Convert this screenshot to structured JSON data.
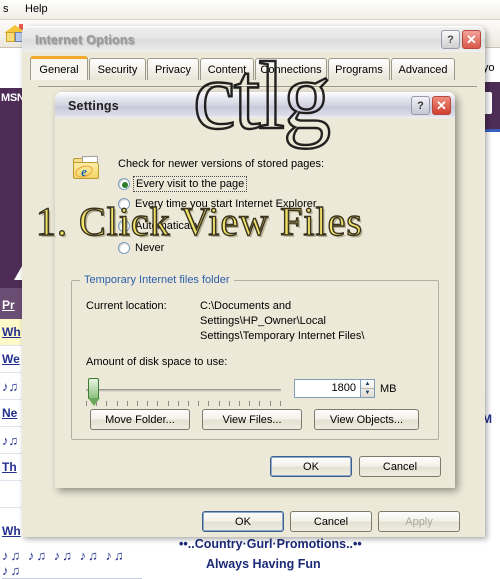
{
  "background": {
    "menu": [
      {
        "label": "s",
        "name": "menu-tools-partial"
      },
      {
        "label": "Help",
        "name": "menu-help",
        "accel": "H"
      }
    ],
    "home_icon": "home-icon",
    "msn_label": "MSN",
    "right_text": "er yo",
    "right_excl": "!",
    "right_m": "M",
    "link_rows": [
      {
        "label": "Pr",
        "style": "pur"
      },
      {
        "label": "Wh",
        "style": "hl"
      },
      {
        "label": "We",
        "style": "plain"
      },
      {
        "label": "♪♫",
        "style": "notes"
      },
      {
        "label": "Ne",
        "style": "plain"
      },
      {
        "label": "♪♫",
        "style": "notes"
      },
      {
        "label": "Th",
        "style": "plain"
      },
      {
        "label": "",
        "style": "plain"
      }
    ],
    "wh_row": "Wh",
    "notes_row": "♪♫ ♪♫ ♪♫ ♪♫ ♪♫ ♪♫",
    "bottom_line1": "••..Country·Gurl·Promotions..••",
    "bottom_line2": "Always Having Fun"
  },
  "watermarks": {
    "brand": "ctlg",
    "step": "1. Click View Files"
  },
  "internet_options": {
    "title": "Internet Options",
    "help_button": "?",
    "close_button": "✕",
    "tabs": [
      {
        "label": "General",
        "selected": true
      },
      {
        "label": "Security",
        "selected": false
      },
      {
        "label": "Privacy",
        "selected": false
      },
      {
        "label": "Content",
        "selected": false
      },
      {
        "label": "Connections",
        "selected": false
      },
      {
        "label": "Programs",
        "selected": false
      },
      {
        "label": "Advanced",
        "selected": false
      }
    ],
    "footer": {
      "ok": "OK",
      "cancel": "Cancel",
      "apply": "Apply",
      "apply_disabled": true
    }
  },
  "settings_dialog": {
    "title": "Settings",
    "help_button": "?",
    "close_button": "✕",
    "check_label": "Check for newer versions of stored pages:",
    "folder_icon": "internet-explorer-folder-icon",
    "radios": [
      {
        "label": "Every visit to the page",
        "accel": "E",
        "selected": true,
        "focused": true
      },
      {
        "label": "Every time you start Internet Explorer",
        "accel": "s",
        "selected": false,
        "focused": false
      },
      {
        "label": "Automatically",
        "accel": "A",
        "selected": false,
        "focused": false
      },
      {
        "label": "Never",
        "accel": "N",
        "selected": false,
        "focused": false
      }
    ],
    "group_title": "Temporary Internet files folder",
    "current_location_label": "Current location:",
    "current_location_value": [
      "C:\\Documents and",
      "Settings\\HP_Owner\\Local",
      "Settings\\Temporary Internet Files\\"
    ],
    "disk_space_label": "Amount of disk space to use:",
    "disk_space_value": "1800",
    "disk_space_unit": "MB",
    "slider_percent": 6,
    "buttons": {
      "move_folder": "Move Folder...",
      "view_files": "View Files...",
      "view_objects": "View Objects..."
    },
    "footer": {
      "ok": "OK",
      "cancel": "Cancel"
    }
  },
  "colors": {
    "accent_tab": "#f0a92c",
    "group_title": "#2b5faa",
    "radio_dot": "#2a7b2a",
    "link": "#23308e",
    "msn_purple": "#4d2d56",
    "watermark_yellow": "#f2e36a",
    "close_red": "#cf3f2e"
  }
}
